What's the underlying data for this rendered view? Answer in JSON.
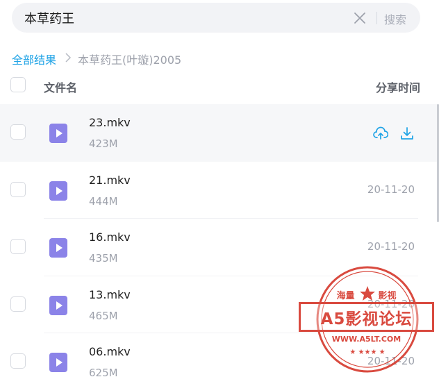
{
  "search": {
    "query": "本草药王",
    "submit_label": "搜索"
  },
  "breadcrumb": {
    "root": "全部结果",
    "current": "本草药王(叶璇)2005"
  },
  "table": {
    "col_name": "文件名",
    "col_time": "分享时间"
  },
  "files": [
    {
      "name": "23.mkv",
      "size": "423M",
      "date": "",
      "hovered": true
    },
    {
      "name": "21.mkv",
      "size": "444M",
      "date": "20-11-20"
    },
    {
      "name": "16.mkv",
      "size": "435M",
      "date": "20-11-20"
    },
    {
      "name": "13.mkv",
      "size": "465M",
      "date": "20-11-20"
    },
    {
      "name": "06.mkv",
      "size": "625M",
      "date": "20-11-20"
    }
  ],
  "icons": {
    "file": "video-file-icon",
    "save": "cloud-upload-icon",
    "download": "download-icon",
    "clear": "close-icon"
  },
  "colors": {
    "accent": "#1fa3e6",
    "file_icon": "#8b83e8",
    "watermark": "#d63b2f"
  },
  "watermark": {
    "top_left": "海量",
    "top_right": "影视",
    "title": "A5影视论坛",
    "url": "WWW.A5LT.COM"
  }
}
